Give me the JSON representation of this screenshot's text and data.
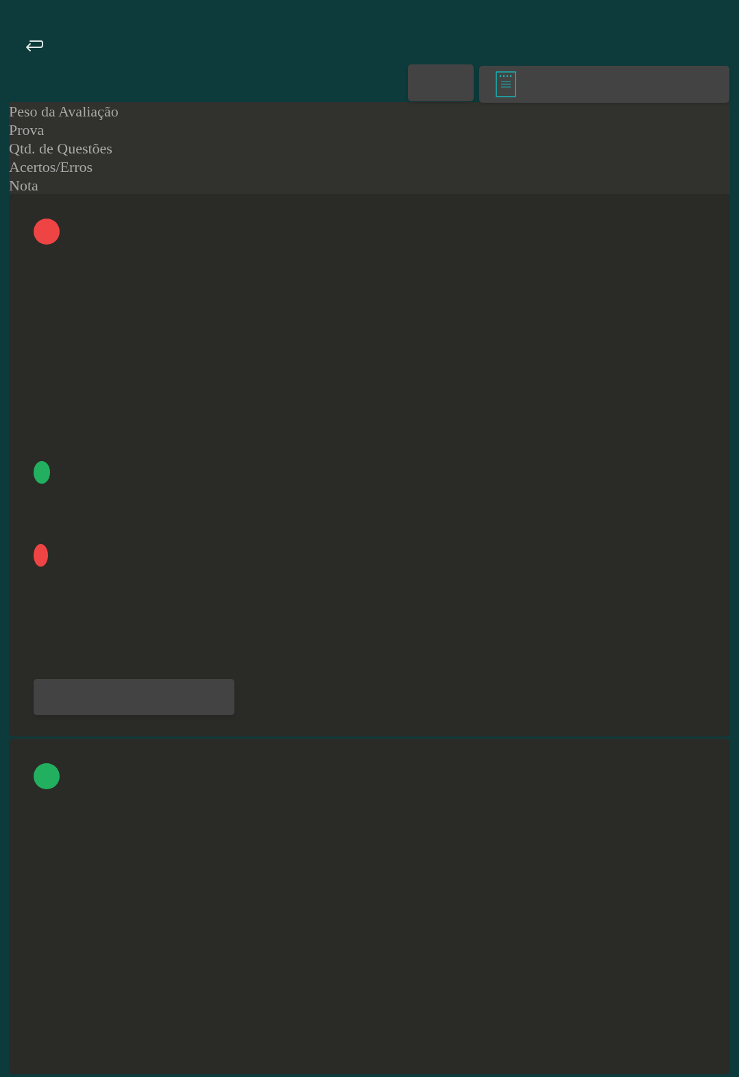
{
  "legend": [
    "Peso da Avaliação",
    "Prova",
    "Qtd. de Questões",
    "Acertos/Erros",
    "Nota"
  ],
  "cards": [
    {
      "kind": "with-button",
      "color": "#ef4444",
      "markers": [
        {
          "color": "#22b060"
        },
        {
          "color": "#ef4444"
        }
      ]
    },
    {
      "kind": "plain",
      "color": "#22b060"
    }
  ]
}
